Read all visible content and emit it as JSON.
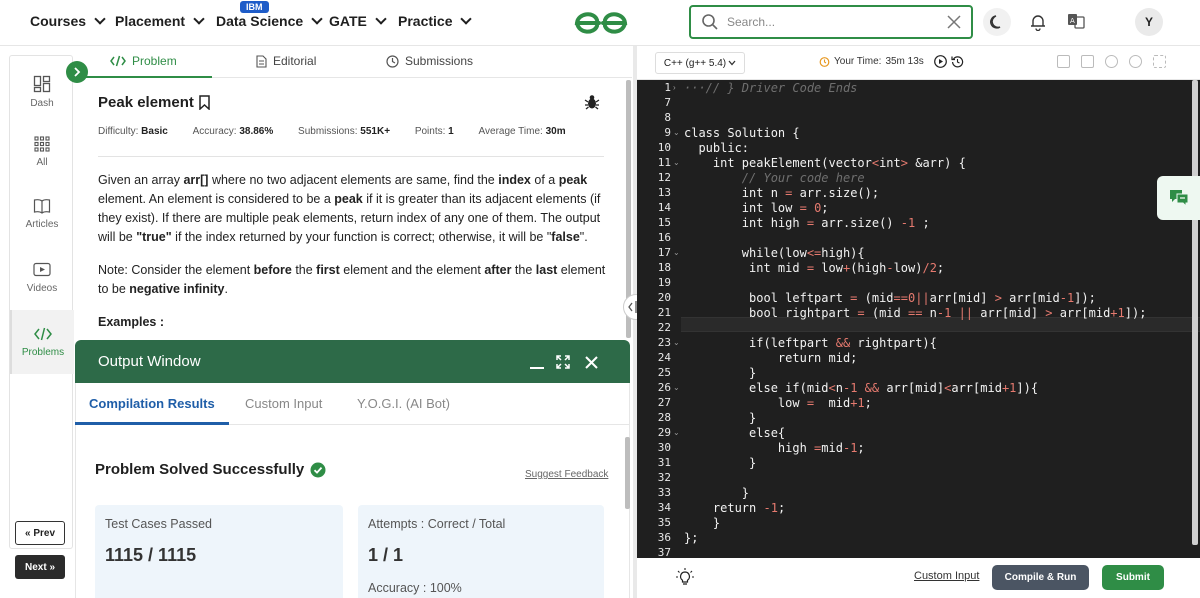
{
  "nav": {
    "items": [
      "Courses",
      "Placement",
      "Data Science",
      "GATE",
      "Practice"
    ],
    "badge": "IBM",
    "search_placeholder": "Search...",
    "avatar": "Y"
  },
  "rail": {
    "items": [
      {
        "label": "Dash",
        "icon": "dashboard-icon"
      },
      {
        "label": "All",
        "icon": "grid-icon"
      },
      {
        "label": "Articles",
        "icon": "book-icon"
      },
      {
        "label": "Videos",
        "icon": "video-icon"
      },
      {
        "label": "Problems",
        "icon": "code-icon"
      }
    ],
    "prev_label": "« Prev",
    "next_label": "Next »"
  },
  "tabs": {
    "problem": "Problem",
    "editorial": "Editorial",
    "submissions": "Submissions"
  },
  "problem": {
    "title": "Peak element",
    "difficulty_label": "Difficulty:",
    "difficulty": "Basic",
    "accuracy_label": "Accuracy:",
    "accuracy": "38.86%",
    "submissions_label": "Submissions:",
    "submissions": "551K+",
    "points_label": "Points:",
    "points": "1",
    "avg_time_label": "Average Time:",
    "avg_time": "30m",
    "examples_label": "Examples :"
  },
  "output": {
    "title": "Output Window",
    "tabs": [
      "Compilation Results",
      "Custom Input",
      "Y.O.G.I. (AI Bot)"
    ],
    "status": "Problem Solved Successfully",
    "feedback": "Suggest Feedback",
    "cards": [
      {
        "label": "Test Cases Passed",
        "value": "1115 / 1115",
        "sub": ""
      },
      {
        "label": "Attempts : Correct / Total",
        "value": "1 / 1",
        "sub": "Accuracy : 100%"
      }
    ]
  },
  "editor": {
    "language": "C++ (g++ 5.4)",
    "timer_label": "Your Time:",
    "timer": "35m 13s",
    "custom_input": "Custom Input",
    "compile_run": "Compile & Run",
    "submit": "Submit",
    "code_lines": [
      {
        "n": "1",
        "fold": "›",
        "html": "<span class=\"c\">···// } Driver Code Ends</span>"
      },
      {
        "n": "7",
        "fold": "",
        "html": ""
      },
      {
        "n": "8",
        "fold": "",
        "html": ""
      },
      {
        "n": "9",
        "fold": "⌄",
        "html": "class Solution {"
      },
      {
        "n": "10",
        "fold": "",
        "html": "  public:"
      },
      {
        "n": "11",
        "fold": "⌄",
        "html": "    int peakElement(vector<span class=\"n\">&lt;</span>int<span class=\"n\">&gt;</span> &amp;arr) {"
      },
      {
        "n": "12",
        "fold": "",
        "html": "        <span class=\"c\">// Your code here</span>"
      },
      {
        "n": "13",
        "fold": "",
        "html": "        int n <span class=\"n\">=</span> arr.size();"
      },
      {
        "n": "14",
        "fold": "",
        "html": "        int low <span class=\"n\">=</span> <span class=\"n\">0</span>;"
      },
      {
        "n": "15",
        "fold": "",
        "html": "        int high <span class=\"n\">=</span> arr.size() <span class=\"n\">-1</span> ;"
      },
      {
        "n": "16",
        "fold": "",
        "html": ""
      },
      {
        "n": "17",
        "fold": "⌄",
        "html": "        while(low<span class=\"n\">&lt;=</span>high){"
      },
      {
        "n": "18",
        "fold": "",
        "html": "         int mid <span class=\"n\">=</span> low<span class=\"n\">+</span>(high<span class=\"n\">-</span>low)<span class=\"n\">/2</span>;"
      },
      {
        "n": "19",
        "fold": "",
        "html": ""
      },
      {
        "n": "20",
        "fold": "",
        "html": "         bool leftpart <span class=\"n\">=</span> (mid<span class=\"n\">==0||</span>arr[mid] <span class=\"n\">&gt;</span> arr[mid<span class=\"n\">-1</span>]);"
      },
      {
        "n": "21",
        "fold": "",
        "html": "         bool rightpart <span class=\"n\">=</span> (mid <span class=\"n\">==</span> n<span class=\"n\">-1 ||</span> arr[mid] <span class=\"n\">&gt;</span> arr[mid<span class=\"n\">+1</span>]);"
      },
      {
        "n": "22",
        "fold": "",
        "html": ""
      },
      {
        "n": "23",
        "fold": "⌄",
        "html": "         if(leftpart <span class=\"n\">&amp;&amp;</span> rightpart){"
      },
      {
        "n": "24",
        "fold": "",
        "html": "             return mid;"
      },
      {
        "n": "25",
        "fold": "",
        "html": "         }"
      },
      {
        "n": "26",
        "fold": "⌄",
        "html": "         else if(mid<span class=\"n\">&lt;</span>n<span class=\"n\">-1 &amp;&amp;</span> arr[mid]<span class=\"n\">&lt;</span>arr[mid<span class=\"n\">+1</span>]){"
      },
      {
        "n": "27",
        "fold": "",
        "html": "             low <span class=\"n\">=</span>  mid<span class=\"n\">+1</span>;"
      },
      {
        "n": "28",
        "fold": "",
        "html": "         }"
      },
      {
        "n": "29",
        "fold": "⌄",
        "html": "         else{"
      },
      {
        "n": "30",
        "fold": "",
        "html": "             high <span class=\"n\">=</span>mid<span class=\"n\">-1</span>;"
      },
      {
        "n": "31",
        "fold": "",
        "html": "         }"
      },
      {
        "n": "32",
        "fold": "",
        "html": ""
      },
      {
        "n": "33",
        "fold": "",
        "html": "        }"
      },
      {
        "n": "34",
        "fold": "",
        "html": "    return <span class=\"n\">-1</span>;"
      },
      {
        "n": "35",
        "fold": "",
        "html": "    }"
      },
      {
        "n": "36",
        "fold": "",
        "html": "};"
      },
      {
        "n": "37",
        "fold": "",
        "html": ""
      }
    ]
  },
  "colors": {
    "brand_green": "#2f8d46",
    "output_header": "#2d6a48",
    "link_blue": "#1f5ea8",
    "editor_bg": "#1f1f1f"
  }
}
